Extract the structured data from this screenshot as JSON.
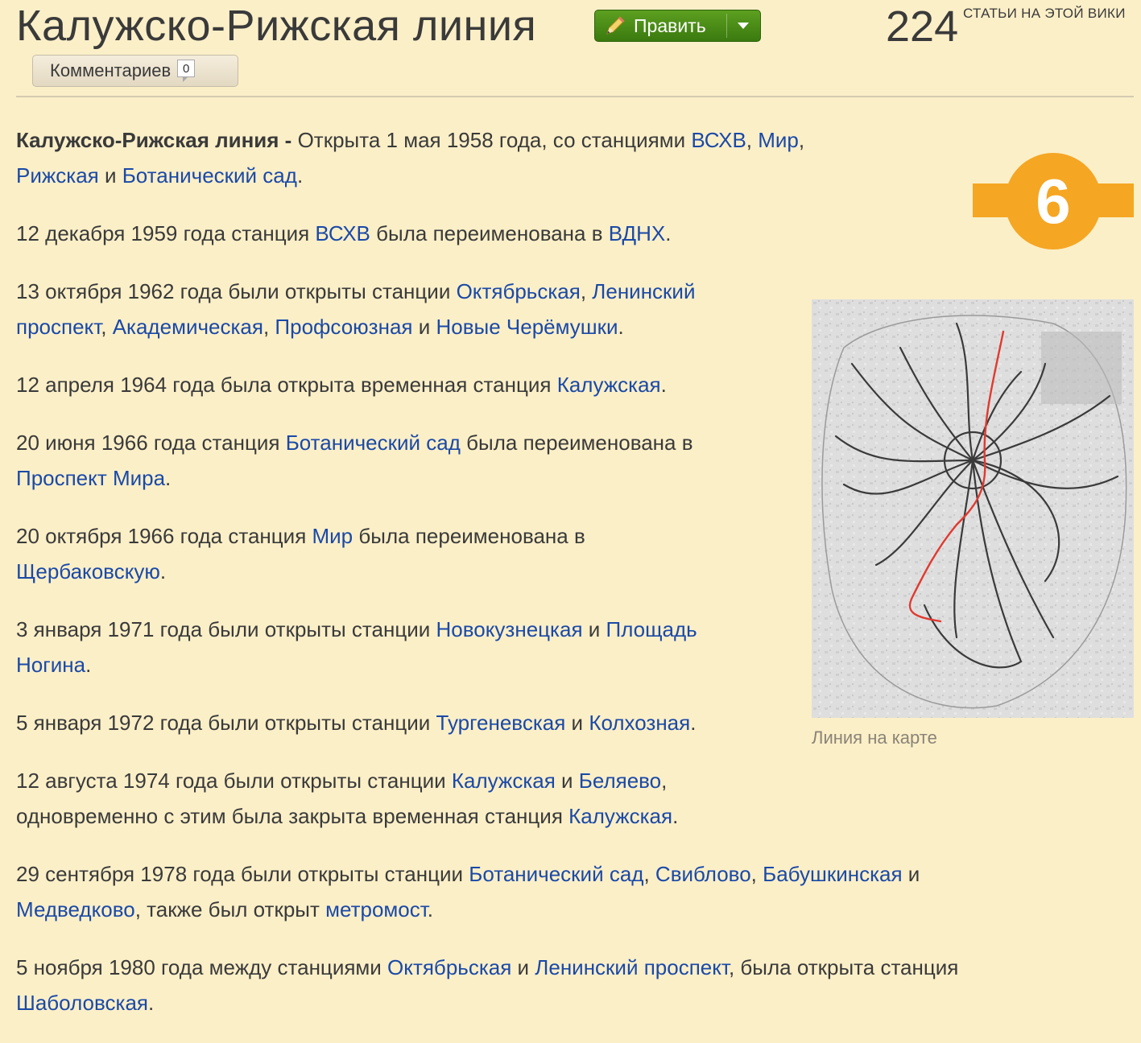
{
  "page": {
    "title": "Калужско-Рижская линия",
    "edit_label": "Править",
    "counter_value": "224",
    "counter_label": "СТАТЬИ НА ЭТОЙ ВИКИ",
    "comments_label": "Комментариев",
    "comments_count": "0"
  },
  "badge": {
    "number": "6",
    "color": "#f5a623"
  },
  "map": {
    "caption": "Линия на карте",
    "line_color": "#e03a30"
  },
  "colors": {
    "background": "#fbefc8",
    "link": "#1a49a7",
    "edit_button": "#4a8c17"
  },
  "paragraphs": [
    [
      {
        "t": "Калужско-Рижская линия -",
        "b": true
      },
      {
        "t": " Открыта 1 мая 1958 года, со станциями "
      },
      {
        "t": "ВСХВ",
        "link": true
      },
      {
        "t": ", "
      },
      {
        "t": "Мир",
        "link": true
      },
      {
        "t": ","
      },
      {
        "br": true
      },
      {
        "t": "Рижская",
        "link": true
      },
      {
        "t": " и "
      },
      {
        "t": "Ботанический сад",
        "link": true
      },
      {
        "t": "."
      }
    ],
    [
      {
        "t": "12 декабря 1959 года станция "
      },
      {
        "t": "ВСХВ",
        "link": true
      },
      {
        "t": " была переименована в "
      },
      {
        "t": "ВДНХ",
        "link": true
      },
      {
        "t": "."
      }
    ],
    [
      {
        "t": "13 октября 1962 года были открыты станции "
      },
      {
        "t": "Октябрьская",
        "link": true
      },
      {
        "t": ", "
      },
      {
        "t": "Ленинский",
        "link": true
      },
      {
        "br": true
      },
      {
        "t": "проспект",
        "link": true
      },
      {
        "t": ", "
      },
      {
        "t": "Академическая",
        "link": true
      },
      {
        "t": ", "
      },
      {
        "t": "Профсоюзная",
        "link": true
      },
      {
        "t": " и "
      },
      {
        "t": "Новые Черёмушки",
        "link": true
      },
      {
        "t": "."
      }
    ],
    [
      {
        "t": "12 апреля 1964 года была открыта временная станция "
      },
      {
        "t": "Калужская",
        "link": true
      },
      {
        "t": "."
      }
    ],
    [
      {
        "t": "20 июня 1966 года станция "
      },
      {
        "t": "Ботанический сад",
        "link": true
      },
      {
        "t": " была переименована в"
      },
      {
        "br": true
      },
      {
        "t": "Проспект Мира",
        "link": true
      },
      {
        "t": "."
      }
    ],
    [
      {
        "t": "20 октября 1966 года станция "
      },
      {
        "t": "Мир",
        "link": true
      },
      {
        "t": " была переименована в"
      },
      {
        "br": true
      },
      {
        "t": "Щербаковскую",
        "link": true
      },
      {
        "t": "."
      }
    ],
    [
      {
        "t": "3 января 1971 года были открыты станции "
      },
      {
        "t": "Новокузнецкая",
        "link": true
      },
      {
        "t": " и "
      },
      {
        "t": "Площадь",
        "link": true
      },
      {
        "br": true
      },
      {
        "t": "Ногина",
        "link": true
      },
      {
        "t": "."
      }
    ],
    [
      {
        "t": "5 января 1972 года были открыты станции "
      },
      {
        "t": "Тургеневская",
        "link": true
      },
      {
        "t": " и "
      },
      {
        "t": "Колхозная",
        "link": true
      },
      {
        "t": "."
      }
    ],
    [
      {
        "t": "12 августа 1974 года были открыты станции "
      },
      {
        "t": "Калужская",
        "link": true
      },
      {
        "t": " и "
      },
      {
        "t": "Беляево",
        "link": true
      },
      {
        "t": ","
      },
      {
        "br": true
      },
      {
        "t": "одновременно с этим была закрыта временная станция "
      },
      {
        "t": "Калужская",
        "link": true
      },
      {
        "t": "."
      }
    ],
    [
      {
        "t": "29 сентября 1978 года были открыты станции "
      },
      {
        "t": "Ботанический сад",
        "link": true
      },
      {
        "t": ", "
      },
      {
        "t": "Свиблово",
        "link": true
      },
      {
        "t": ", "
      },
      {
        "t": "Бабушкинская",
        "link": true
      },
      {
        "t": " и"
      },
      {
        "br": true
      },
      {
        "t": "Медведково",
        "link": true
      },
      {
        "t": ", также был открыт "
      },
      {
        "t": "метромост",
        "link": true
      },
      {
        "t": "."
      }
    ],
    [
      {
        "t": "5 ноября 1980 года между станциями "
      },
      {
        "t": "Октябрьская",
        "link": true
      },
      {
        "t": " и "
      },
      {
        "t": "Ленинский проспект",
        "link": true
      },
      {
        "t": ", была открыта станция"
      },
      {
        "br": true
      },
      {
        "t": "Шаболовская",
        "link": true
      },
      {
        "t": "."
      }
    ]
  ]
}
